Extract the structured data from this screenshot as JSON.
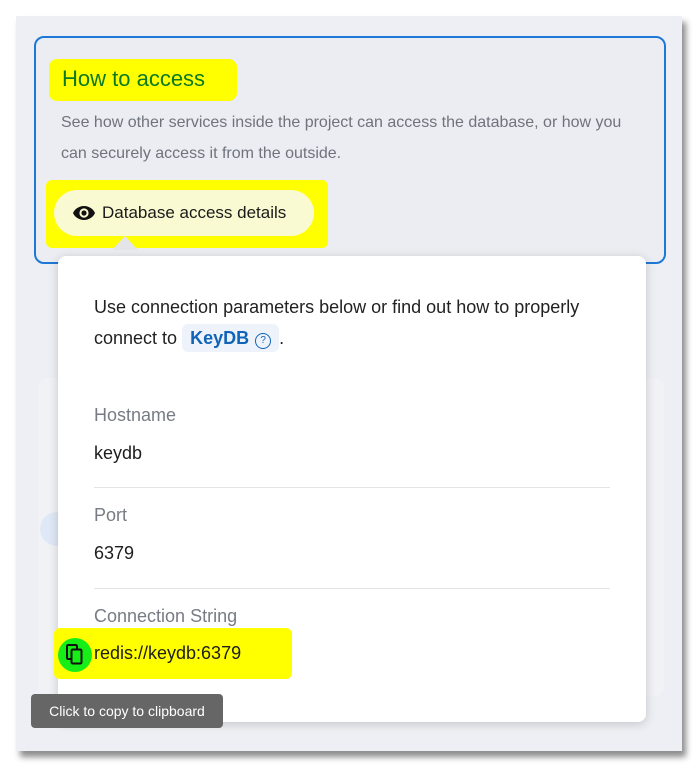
{
  "access": {
    "title": "How to access",
    "description": "See how other services inside the project can access the database, or how you can securely access it from the outside.",
    "details_button_label": "Database access details"
  },
  "popover": {
    "intro_before": "Use connection parameters below or find out how to properly connect to",
    "chip_label": "KeyDB",
    "intro_after": ".",
    "fields": [
      {
        "label": "Hostname",
        "value": "keydb"
      },
      {
        "label": "Port",
        "value": "6379"
      },
      {
        "label": "Connection String",
        "value": "redis://keydb:6379"
      }
    ]
  },
  "tooltip": {
    "text": "Click to copy to clipboard"
  },
  "icons": {
    "details_button": "eye-icon",
    "chip": "help-circle-icon",
    "copy": "copy-icon"
  },
  "colors": {
    "card_border": "#1e79d6",
    "title": "#0a7a24",
    "highlight": "#ffff00",
    "copy_button": "#17ee17",
    "chip_text": "#1064b8"
  }
}
